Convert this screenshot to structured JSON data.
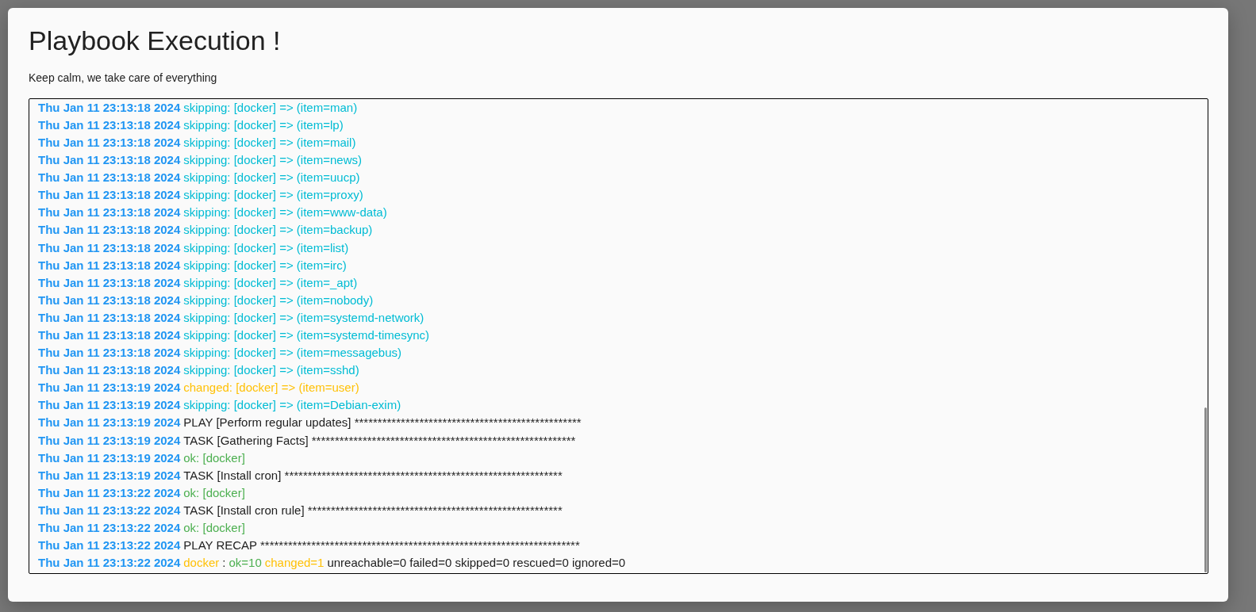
{
  "dialog": {
    "title": "Playbook Execution !",
    "subtitle": "Keep calm, we take care of everything"
  },
  "log": {
    "lines": [
      {
        "timestamp": "Thu Jan 11 23:13:18 2024",
        "segments": [
          {
            "kind": "skipping",
            "text": "skipping: [docker] => (item=man)"
          }
        ]
      },
      {
        "timestamp": "Thu Jan 11 23:13:18 2024",
        "segments": [
          {
            "kind": "skipping",
            "text": "skipping: [docker] => (item=lp)"
          }
        ]
      },
      {
        "timestamp": "Thu Jan 11 23:13:18 2024",
        "segments": [
          {
            "kind": "skipping",
            "text": "skipping: [docker] => (item=mail)"
          }
        ]
      },
      {
        "timestamp": "Thu Jan 11 23:13:18 2024",
        "segments": [
          {
            "kind": "skipping",
            "text": "skipping: [docker] => (item=news)"
          }
        ]
      },
      {
        "timestamp": "Thu Jan 11 23:13:18 2024",
        "segments": [
          {
            "kind": "skipping",
            "text": "skipping: [docker] => (item=uucp)"
          }
        ]
      },
      {
        "timestamp": "Thu Jan 11 23:13:18 2024",
        "segments": [
          {
            "kind": "skipping",
            "text": "skipping: [docker] => (item=proxy)"
          }
        ]
      },
      {
        "timestamp": "Thu Jan 11 23:13:18 2024",
        "segments": [
          {
            "kind": "skipping",
            "text": "skipping: [docker] => (item=www-data)"
          }
        ]
      },
      {
        "timestamp": "Thu Jan 11 23:13:18 2024",
        "segments": [
          {
            "kind": "skipping",
            "text": "skipping: [docker] => (item=backup)"
          }
        ]
      },
      {
        "timestamp": "Thu Jan 11 23:13:18 2024",
        "segments": [
          {
            "kind": "skipping",
            "text": "skipping: [docker] => (item=list)"
          }
        ]
      },
      {
        "timestamp": "Thu Jan 11 23:13:18 2024",
        "segments": [
          {
            "kind": "skipping",
            "text": "skipping: [docker] => (item=irc)"
          }
        ]
      },
      {
        "timestamp": "Thu Jan 11 23:13:18 2024",
        "segments": [
          {
            "kind": "skipping",
            "text": "skipping: [docker] => (item=_apt)"
          }
        ]
      },
      {
        "timestamp": "Thu Jan 11 23:13:18 2024",
        "segments": [
          {
            "kind": "skipping",
            "text": "skipping: [docker] => (item=nobody)"
          }
        ]
      },
      {
        "timestamp": "Thu Jan 11 23:13:18 2024",
        "segments": [
          {
            "kind": "skipping",
            "text": "skipping: [docker] => (item=systemd-network)"
          }
        ]
      },
      {
        "timestamp": "Thu Jan 11 23:13:18 2024",
        "segments": [
          {
            "kind": "skipping",
            "text": "skipping: [docker] => (item=systemd-timesync)"
          }
        ]
      },
      {
        "timestamp": "Thu Jan 11 23:13:18 2024",
        "segments": [
          {
            "kind": "skipping",
            "text": "skipping: [docker] => (item=messagebus)"
          }
        ]
      },
      {
        "timestamp": "Thu Jan 11 23:13:18 2024",
        "segments": [
          {
            "kind": "skipping",
            "text": "skipping: [docker] => (item=sshd)"
          }
        ]
      },
      {
        "timestamp": "Thu Jan 11 23:13:19 2024",
        "segments": [
          {
            "kind": "changed",
            "text": "changed: [docker] => (item=user)"
          }
        ]
      },
      {
        "timestamp": "Thu Jan 11 23:13:19 2024",
        "segments": [
          {
            "kind": "skipping",
            "text": "skipping: [docker] => (item=Debian-exim)"
          }
        ]
      },
      {
        "timestamp": "Thu Jan 11 23:13:19 2024",
        "segments": [
          {
            "kind": "plain",
            "text": "PLAY [Perform regular updates] *************************************************"
          }
        ]
      },
      {
        "timestamp": "Thu Jan 11 23:13:19 2024",
        "segments": [
          {
            "kind": "plain",
            "text": "TASK [Gathering Facts] *********************************************************"
          }
        ]
      },
      {
        "timestamp": "Thu Jan 11 23:13:19 2024",
        "segments": [
          {
            "kind": "ok",
            "text": "ok: [docker]"
          }
        ]
      },
      {
        "timestamp": "Thu Jan 11 23:13:19 2024",
        "segments": [
          {
            "kind": "plain",
            "text": "TASK [Install cron] ************************************************************"
          }
        ]
      },
      {
        "timestamp": "Thu Jan 11 23:13:22 2024",
        "segments": [
          {
            "kind": "ok",
            "text": "ok: [docker]"
          }
        ]
      },
      {
        "timestamp": "Thu Jan 11 23:13:22 2024",
        "segments": [
          {
            "kind": "plain",
            "text": "TASK [Install cron rule] *******************************************************"
          }
        ]
      },
      {
        "timestamp": "Thu Jan 11 23:13:22 2024",
        "segments": [
          {
            "kind": "ok",
            "text": "ok: [docker]"
          }
        ]
      },
      {
        "timestamp": "Thu Jan 11 23:13:22 2024",
        "segments": [
          {
            "kind": "plain",
            "text": "PLAY RECAP *********************************************************************"
          }
        ]
      },
      {
        "timestamp": "Thu Jan 11 23:13:22 2024",
        "segments": [
          {
            "kind": "changed",
            "text": "docker"
          },
          {
            "kind": "plain",
            "text": ":"
          },
          {
            "kind": "ok",
            "text": "ok=10"
          },
          {
            "kind": "changed",
            "text": "changed=1"
          },
          {
            "kind": "plain",
            "text": "unreachable=0 failed=0 skipped=0 rescued=0 ignored=0"
          }
        ]
      }
    ]
  }
}
